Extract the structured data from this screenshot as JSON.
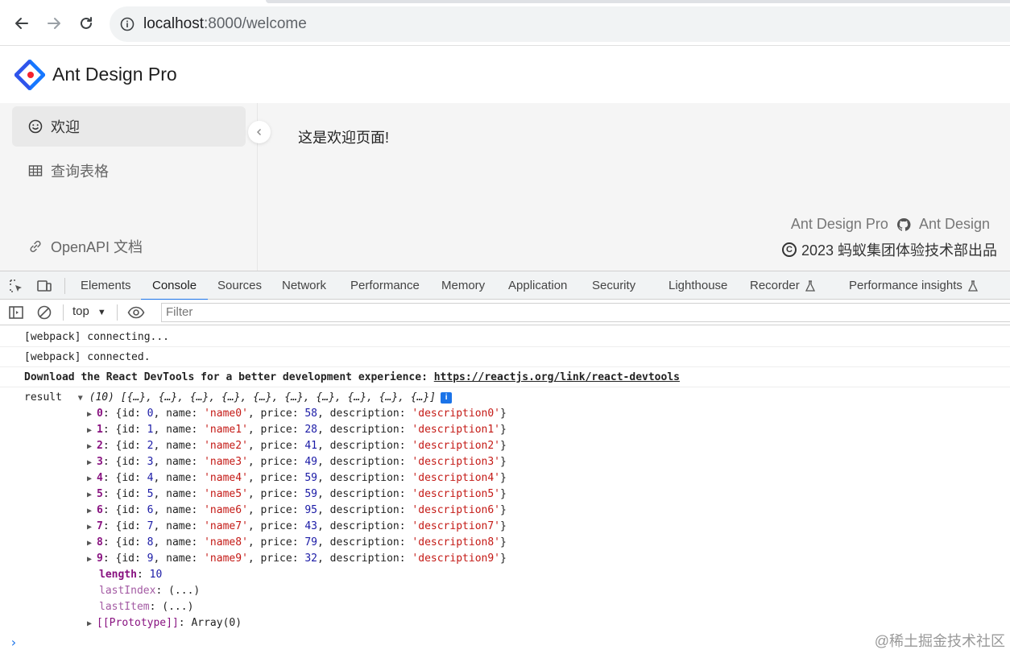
{
  "browser": {
    "url_host": "localhost",
    "url_path": ":8000/welcome"
  },
  "app": {
    "title": "Ant Design Pro",
    "menu": [
      {
        "label": "欢迎",
        "icon": "smile-icon"
      },
      {
        "label": "查询表格",
        "icon": "table-icon"
      },
      {
        "label": "OpenAPI 文档",
        "icon": "link-icon"
      }
    ],
    "welcome_text": "这是欢迎页面!",
    "footer": {
      "link1": "Ant Design Pro",
      "link2": "Ant Design",
      "copyright": "2023 蚂蚁集团体验技术部出品"
    }
  },
  "devtools": {
    "tabs": [
      "Elements",
      "Console",
      "Sources",
      "Network",
      "Performance",
      "Memory",
      "Application",
      "Security",
      "Lighthouse",
      "Recorder",
      "Performance insights"
    ],
    "active_tab": "Console",
    "context": "top",
    "filter_placeholder": "Filter",
    "logs": {
      "line1": "[webpack] connecting...",
      "line2": "[webpack] connected.",
      "line3_text": "Download the React DevTools for a better development experience: ",
      "line3_link": "https://reactjs.org/link/react-devtools"
    },
    "result": {
      "label": "result",
      "summary": "(10) [{…}, {…}, {…}, {…}, {…}, {…}, {…}, {…}, {…}, {…}]",
      "items": [
        {
          "id": 0,
          "name": "'name0'",
          "price": 58,
          "description": "'description0'"
        },
        {
          "id": 1,
          "name": "'name1'",
          "price": 28,
          "description": "'description1'"
        },
        {
          "id": 2,
          "name": "'name2'",
          "price": 41,
          "description": "'description2'"
        },
        {
          "id": 3,
          "name": "'name3'",
          "price": 49,
          "description": "'description3'"
        },
        {
          "id": 4,
          "name": "'name4'",
          "price": 59,
          "description": "'description4'"
        },
        {
          "id": 5,
          "name": "'name5'",
          "price": 59,
          "description": "'description5'"
        },
        {
          "id": 6,
          "name": "'name6'",
          "price": 95,
          "description": "'description6'"
        },
        {
          "id": 7,
          "name": "'name7'",
          "price": 43,
          "description": "'description7'"
        },
        {
          "id": 8,
          "name": "'name8'",
          "price": 79,
          "description": "'description8'"
        },
        {
          "id": 9,
          "name": "'name9'",
          "price": 32,
          "description": "'description9'"
        }
      ],
      "length_label": "length",
      "length_value": "10",
      "last_index_label": "lastIndex",
      "last_item_label": "lastItem",
      "lazy_value": "(...)",
      "prototype_label": "[[Prototype]]",
      "prototype_value": "Array(0)"
    }
  },
  "watermark": "@稀土掘金技术社区"
}
